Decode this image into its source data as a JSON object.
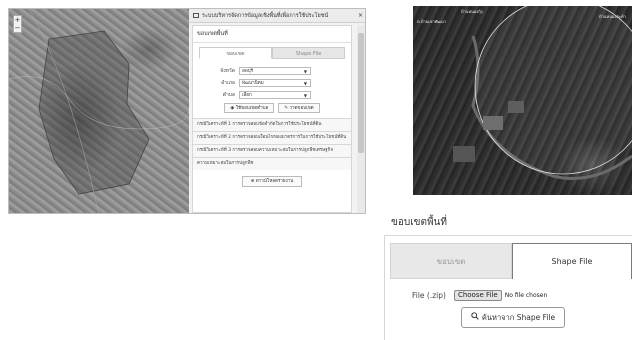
{
  "left_panel": {
    "header_title": "ระบบบริหารจัดการข้อมูลเชิงพื้นที่เพื่อการใช้ประโยชน์",
    "close_glyph": "×",
    "section_title": "ขอบเขตพื้นที่",
    "zoom_in": "+",
    "zoom_out": "−",
    "tabs": {
      "boundary": "ขอบเขต",
      "shapefile": "Shape File"
    },
    "fields": [
      {
        "label": "จังหวัด",
        "value": "ลพบุรี"
      },
      {
        "label": "อำเภอ",
        "value": "พัฒนานิคม"
      },
      {
        "label": "ตำบล",
        "value": "เลือก"
      }
    ],
    "buttons": {
      "use_boundary": "ใช้ขอบเขตตำบล",
      "draw": "วาดขอบเขต"
    },
    "sections": [
      "กรณีวิเคราะห์ที่ 1 การตรวจสอบข้อจำกัดในการใช้ประโยชน์ที่ดิน",
      "กรณีวิเคราะห์ที่ 2 การตรวจสอบเงื่อนไขของมาตรการในการใช้ประโยชน์ที่ดิน",
      "กรณีวิเคราะห์ที่ 3 การตรวจสอบความเหมาะสมในการปลูกพืชเศรษฐกิจ",
      "ความเหมาะสมในการปลูกพืช"
    ],
    "download": "ดาวน์โหลดรายงาน"
  },
  "satellite": {
    "labels": {
      "left": "ต.บ้านเขาพัฒนา",
      "top": "บ้านหนองกุ้ง",
      "right": "บ้านหนองตะค้า"
    }
  },
  "zoomed_panel": {
    "title": "ขอบเขตพื้นที่",
    "tabs": {
      "boundary": "ขอบเขต",
      "shapefile": "Shape File"
    },
    "file_label": "File (.zip)",
    "choose_button": "Choose File",
    "no_file": "No file chosen",
    "search_button": "ค้นหาจาก Shape File",
    "search_icon": "magnifier-icon"
  }
}
